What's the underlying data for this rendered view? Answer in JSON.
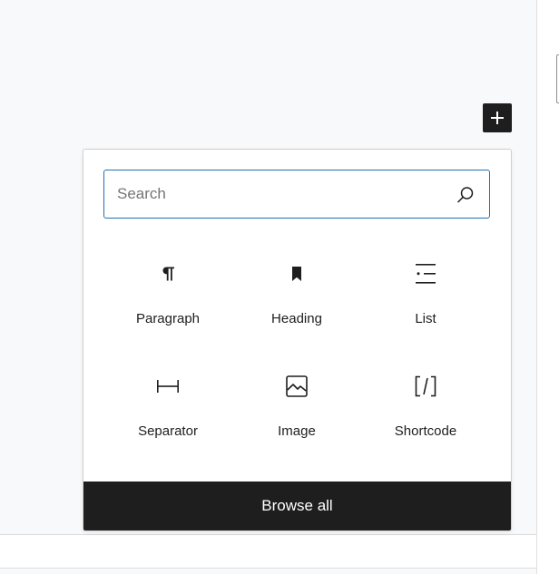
{
  "inserter": {
    "toggle_icon": "plus-icon",
    "search": {
      "placeholder": "Search",
      "value": "",
      "icon": "search-icon"
    },
    "blocks": [
      {
        "label": "Paragraph",
        "icon": "paragraph-icon"
      },
      {
        "label": "Heading",
        "icon": "heading-bookmark-icon"
      },
      {
        "label": "List",
        "icon": "list-icon"
      },
      {
        "label": "Separator",
        "icon": "separator-icon"
      },
      {
        "label": "Image",
        "icon": "image-icon"
      },
      {
        "label": "Shortcode",
        "icon": "shortcode-icon"
      }
    ],
    "browse_all_label": "Browse all"
  },
  "colors": {
    "accent": "#2271b1",
    "dark": "#1e1e1e",
    "canvas_bg": "#f8f9fb"
  }
}
